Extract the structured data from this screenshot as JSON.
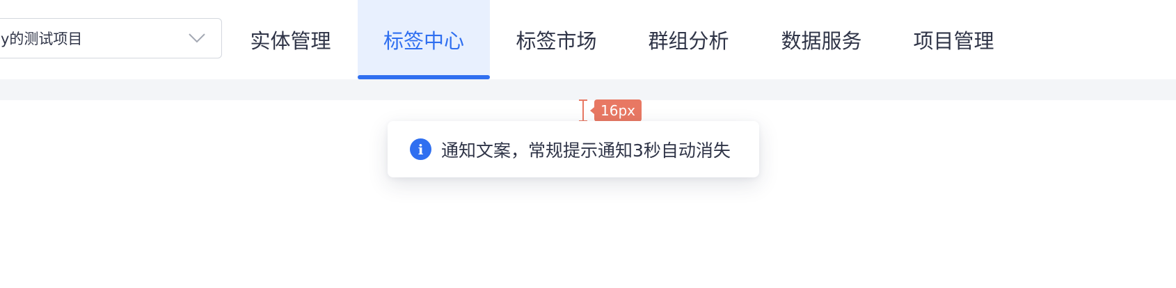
{
  "project_select": {
    "value": "y的测试项目"
  },
  "nav": {
    "items": [
      {
        "label": "实体管理",
        "active": false
      },
      {
        "label": "标签中心",
        "active": true
      },
      {
        "label": "标签市场",
        "active": false
      },
      {
        "label": "群组分析",
        "active": false
      },
      {
        "label": "数据服务",
        "active": false
      },
      {
        "label": "项目管理",
        "active": false
      }
    ]
  },
  "annotation": {
    "spacing_label": "16px",
    "color": "#e87863"
  },
  "toast": {
    "icon": "info-icon",
    "icon_glyph": "i",
    "message": "通知文案，常规提示通知3秒自动消失"
  },
  "colors": {
    "accent": "#2f6ff0",
    "active_bg": "#e8f0fe",
    "text": "#2f3447"
  }
}
